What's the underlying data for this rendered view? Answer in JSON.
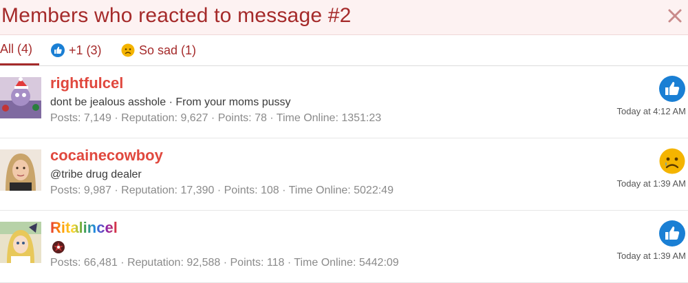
{
  "header": {
    "title": "Members who reacted to message #2"
  },
  "tabs": [
    {
      "label": "All (4)"
    },
    {
      "label": "+1 (3)"
    },
    {
      "label": "So sad (1)"
    }
  ],
  "colors": {
    "accent": "#a52a2a",
    "username": "#e0483e",
    "like_blue": "#1a7fd4",
    "sad_yellow": "#f4b400"
  },
  "members": [
    {
      "username": "rightfulcel",
      "title": "dont be jealous asshole · From your moms pussy",
      "stats": "Posts: 7,149 · Reputation: 9,627 · Points: 78 · Time Online: 1351:23",
      "reaction": "thumbs-up-icon",
      "time": "Today at 4:12 AM"
    },
    {
      "username": "cocainecowboy",
      "title": "@tribe drug dealer",
      "stats": "Posts: 9,987 · Reputation: 17,390 · Points: 108 · Time Online: 5022:49",
      "reaction": "sad-face-icon",
      "time": "Today at 1:39 AM"
    },
    {
      "username": "Ritalincel",
      "title": "",
      "stats": "Posts: 66,481 · Reputation: 92,588 · Points: 118 · Time Online: 5442:09",
      "reaction": "thumbs-up-icon",
      "time": "Today at 1:39 AM"
    }
  ]
}
